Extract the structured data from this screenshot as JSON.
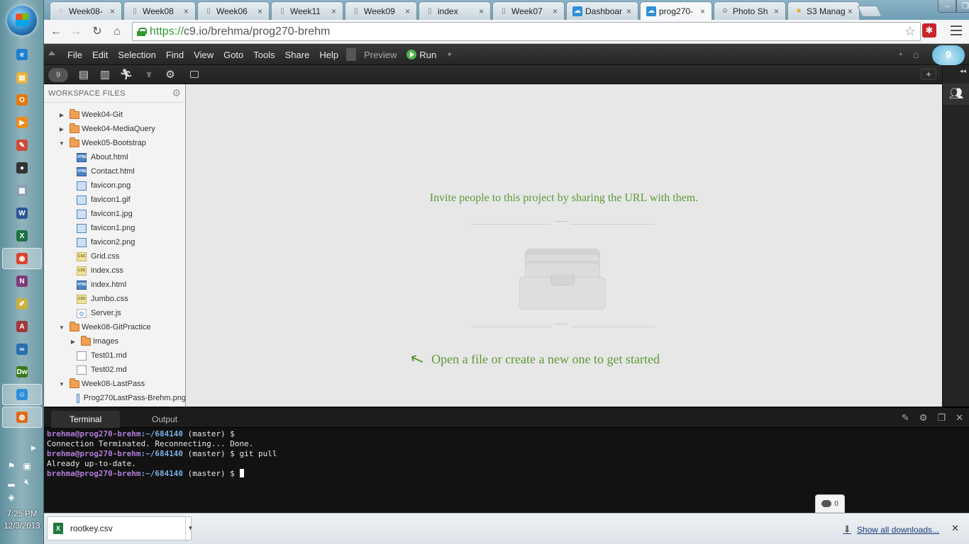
{
  "browser": {
    "tabs": [
      {
        "title": "Week08-",
        "icon": "spinner"
      },
      {
        "title": "Week08",
        "icon": "page"
      },
      {
        "title": "Week06",
        "icon": "page"
      },
      {
        "title": "Week11",
        "icon": "page"
      },
      {
        "title": "Week09",
        "icon": "page"
      },
      {
        "title": "index",
        "icon": "page"
      },
      {
        "title": "Week07",
        "icon": "page"
      },
      {
        "title": "Dashboar",
        "icon": "c9-cloud"
      },
      {
        "title": "prog270-",
        "icon": "c9-cloud",
        "active": true
      },
      {
        "title": "Photo Sh",
        "icon": "smiley"
      },
      {
        "title": "S3 Manag",
        "icon": "aws-box"
      }
    ],
    "url_scheme": "https://",
    "url_rest": "c9.io/brehma/prog270-brehm"
  },
  "c9": {
    "menu": [
      "File",
      "Edit",
      "Selection",
      "Find",
      "View",
      "Goto",
      "Tools",
      "Share",
      "Help"
    ],
    "preview_label": "Preview",
    "run_label": "Run",
    "logo_text": "9",
    "files_header": "WORKSPACE FILES",
    "tree": [
      {
        "label": "Week04-Git",
        "type": "folder",
        "depth": 0,
        "arrow": "▶"
      },
      {
        "label": "Week04-MediaQuery",
        "type": "folder",
        "depth": 0,
        "arrow": "▶"
      },
      {
        "label": "Week05-Bootstrap",
        "type": "folder",
        "depth": 0,
        "arrow": "▼"
      },
      {
        "label": "About.html",
        "type": "html",
        "depth": 1
      },
      {
        "label": "Contact.html",
        "type": "html",
        "depth": 1
      },
      {
        "label": "favicon.png",
        "type": "img",
        "depth": 1
      },
      {
        "label": "favicon1.gif",
        "type": "img",
        "depth": 1
      },
      {
        "label": "favicon1.jpg",
        "type": "img",
        "depth": 1
      },
      {
        "label": "favicon1.png",
        "type": "img",
        "depth": 1
      },
      {
        "label": "favicon2.png",
        "type": "img",
        "depth": 1
      },
      {
        "label": "Grid.css",
        "type": "css",
        "depth": 1
      },
      {
        "label": "index.css",
        "type": "css",
        "depth": 1
      },
      {
        "label": "index.html",
        "type": "html",
        "depth": 1
      },
      {
        "label": "Jumbo.css",
        "type": "css",
        "depth": 1
      },
      {
        "label": "Server.js",
        "type": "js",
        "depth": 1
      },
      {
        "label": "Week08-GitPractice",
        "type": "folder",
        "depth": 0,
        "arrow": "▼"
      },
      {
        "label": "Images",
        "type": "folder",
        "depth": 1,
        "arrow": "▶"
      },
      {
        "label": "Test01.md",
        "type": "md",
        "depth": 1
      },
      {
        "label": "Test02.md",
        "type": "md",
        "depth": 1
      },
      {
        "label": "Week08-LastPass",
        "type": "folder",
        "depth": 0,
        "arrow": "▼"
      },
      {
        "label": "Prog270LastPass-Brehm.png",
        "type": "img",
        "depth": 1
      }
    ],
    "welcome": {
      "invite": "Invite people to this project by sharing the URL with them.",
      "open_hint": "Open a file or create a new one to get started"
    },
    "panel_tabs": {
      "terminal": "Terminal",
      "output": "Output"
    },
    "terminal": {
      "user": "brehma@prog270-brehm",
      "path": ":~/684140",
      "branch": " (master) $ ",
      "lines": [
        {
          "type": "prompt",
          "cmd": ""
        },
        {
          "type": "out",
          "text": "Connection Terminated. Reconnecting... Done."
        },
        {
          "type": "prompt",
          "cmd": "git pull"
        },
        {
          "type": "out",
          "text": "Already up-to-date."
        },
        {
          "type": "prompt",
          "cmd": "",
          "cursor": true
        }
      ]
    },
    "chat_count": "0"
  },
  "downloads": {
    "file_name": "rootkey.csv",
    "show_all": "Show all downloads..."
  },
  "taskbar": {
    "time": "7:25 PM",
    "date": "12/3/2013",
    "apps": [
      {
        "name": "ie-icon",
        "glyph": "e",
        "color": "#1f7fd1"
      },
      {
        "name": "explorer-icon",
        "glyph": "▤",
        "color": "#e8b23a"
      },
      {
        "name": "outlook-icon",
        "glyph": "O",
        "color": "#e07a10"
      },
      {
        "name": "media-player-icon",
        "glyph": "▶",
        "color": "#f08a1c"
      },
      {
        "name": "paint-icon",
        "glyph": "✎",
        "color": "#d04a3a"
      },
      {
        "name": "screen-capture-icon",
        "glyph": "●",
        "color": "#333333"
      },
      {
        "name": "calculator-icon",
        "glyph": "▦",
        "color": "#8aa0b0"
      },
      {
        "name": "word-icon",
        "glyph": "W",
        "color": "#2b5797"
      },
      {
        "name": "excel-icon",
        "glyph": "X",
        "color": "#1e7145"
      },
      {
        "name": "chrome-icon",
        "glyph": "◉",
        "color": "#d9442e",
        "active": true
      },
      {
        "name": "onenote-icon",
        "glyph": "N",
        "color": "#80397b"
      },
      {
        "name": "notepad-icon",
        "glyph": "✐",
        "color": "#c9b23c"
      },
      {
        "name": "access-icon",
        "glyph": "A",
        "color": "#a4373a"
      },
      {
        "name": "infinity-icon",
        "glyph": "∞",
        "color": "#2a6fb0"
      },
      {
        "name": "dreamweaver-icon",
        "glyph": "Dw",
        "color": "#3a7a1a"
      },
      {
        "name": "messenger-icon",
        "glyph": "☺",
        "color": "#2f8fd8",
        "active": true
      },
      {
        "name": "firefox-icon",
        "glyph": "◍",
        "color": "#e06a1a",
        "active": true
      }
    ]
  }
}
